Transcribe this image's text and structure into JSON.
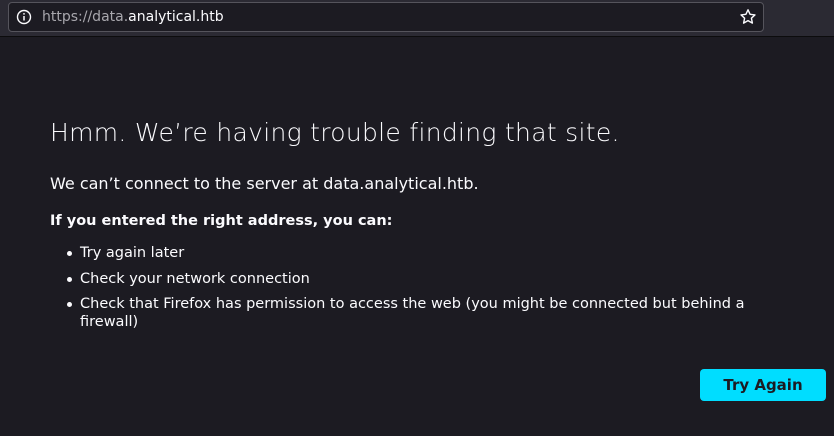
{
  "urlbar": {
    "url_prefix": "https://data.",
    "url_host": "analytical.htb",
    "info_icon": "info-icon",
    "bookmark_icon": "star-icon"
  },
  "error": {
    "title": "Hmm. We’re having trouble finding that site.",
    "description": "We can’t connect to the server at data.analytical.htb.",
    "suggestion_heading": "If you entered the right address, you can:",
    "suggestions": [
      "Try again later",
      "Check your network connection",
      "Check that Firefox has permission to access the web (you might be connected but behind a firewall)"
    ],
    "try_again_label": "Try Again"
  },
  "colors": {
    "background": "#1c1b22",
    "toolbar": "#2b2a33",
    "accent_button": "#00ddff",
    "text": "#fbfbfe"
  }
}
